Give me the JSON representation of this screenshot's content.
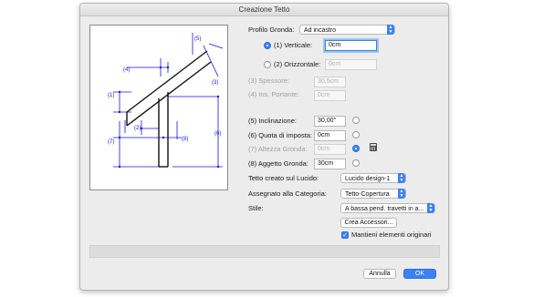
{
  "window": {
    "title": "Creazione Tetto"
  },
  "diagram": {
    "labels": [
      "(5)",
      "(4)",
      "(3)",
      "(1)",
      "(2)",
      "(7)",
      "(6)",
      "(8)"
    ]
  },
  "profilo": {
    "label": "Profilo Gronda:",
    "value": "Ad incastro"
  },
  "verticale": {
    "label": "(1) Verticale:",
    "value": "0cm"
  },
  "orizzontale": {
    "label": "(2) Orizzontale:",
    "value": "0cm"
  },
  "spessore": {
    "label": "(3) Spessore:",
    "value": "30,5cm"
  },
  "ins_portante": {
    "label": "(4) Ins. Portante:",
    "value": "0cm"
  },
  "inclinazione": {
    "label": "(5) Inclinazione:",
    "value": "30,00°"
  },
  "quota_imposta": {
    "label": "(6) Quota di imposta:",
    "value": "0cm"
  },
  "altezza_gronda": {
    "label": "(7) Altezza Gronda:",
    "value": "0cm"
  },
  "aggetto_gronda": {
    "label": "(8) Aggetto Gronda:",
    "value": "30cm"
  },
  "lucido": {
    "label": "Tetto creato sul Lucido:",
    "value": "Lucido design-1"
  },
  "categoria": {
    "label": "Assegnato alla Categoria:",
    "value": "Tetto-Copertura"
  },
  "stile": {
    "label": "Stile:",
    "value": "A bassa pend. travetti in a..."
  },
  "crea_accessori": {
    "label": "Crea Accessori..."
  },
  "mantieni": {
    "label": "Mantieni elementi originari",
    "checked": true
  },
  "buttons": {
    "cancel": "Annulla",
    "ok": "OK"
  },
  "colors": {
    "accent": "#3b82f6",
    "dimension_lines": "#1515e0"
  }
}
